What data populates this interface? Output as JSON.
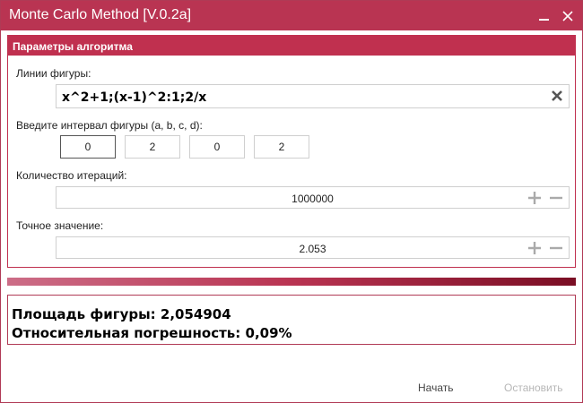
{
  "window": {
    "title": "Monte Carlo Method [V.0.2a]"
  },
  "params": {
    "header": "Параметры алгоритма",
    "figure_lines_label": "Линии фигуры:",
    "figure_lines_value": "x^2+1;(x-1)^2:1;2/x",
    "interval_label": "Введите интервал фигуры (a, b, c, d):",
    "interval": [
      "0",
      "2",
      "0",
      "2"
    ],
    "iterations_label": "Количество итераций:",
    "iterations_value": "1000000",
    "exact_label": "Точное значение:",
    "exact_value": "2.053"
  },
  "progress": {
    "fraction": 1.0
  },
  "results": {
    "area": "Площадь фигуры: 2,054904",
    "error": "Относительная погрешность: 0,09%"
  },
  "buttons": {
    "start": "Начать",
    "stop": "Остановить"
  },
  "colors": {
    "accent": "#b93452",
    "progress_start": "#cc6d87",
    "progress_end": "#7a0e24",
    "disabled_text": "#b7b7b7"
  }
}
